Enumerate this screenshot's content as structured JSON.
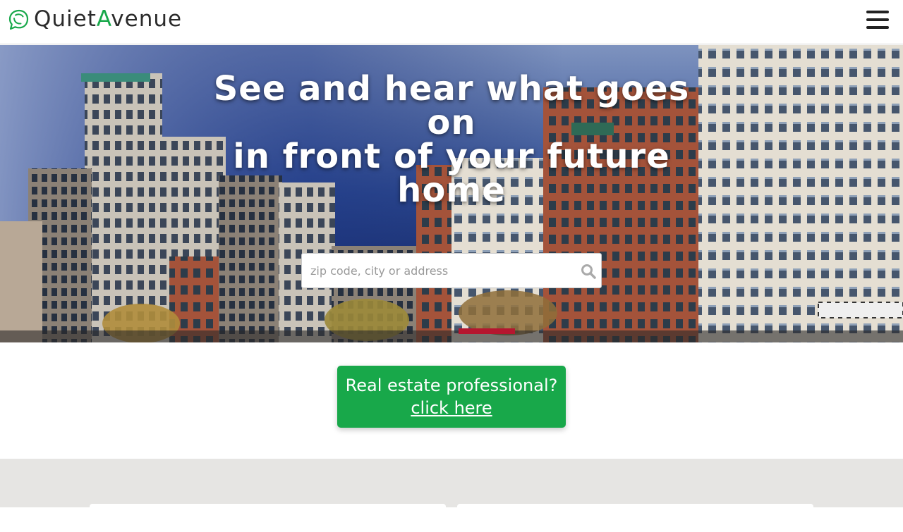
{
  "brand": {
    "name_part1": "Quiet",
    "name_accent": "A",
    "name_part2": "venue",
    "accent_color": "#18a84a"
  },
  "header": {
    "menu_icon": "hamburger-menu-icon"
  },
  "hero": {
    "title_line1": "See and hear what goes on",
    "title_line2": "in front of your future home",
    "search": {
      "placeholder": "zip code, city or address",
      "value": "",
      "icon": "search-icon"
    }
  },
  "pro_cta": {
    "line1": "Real estate professional?",
    "link": "click here",
    "color": "#18a84a"
  }
}
